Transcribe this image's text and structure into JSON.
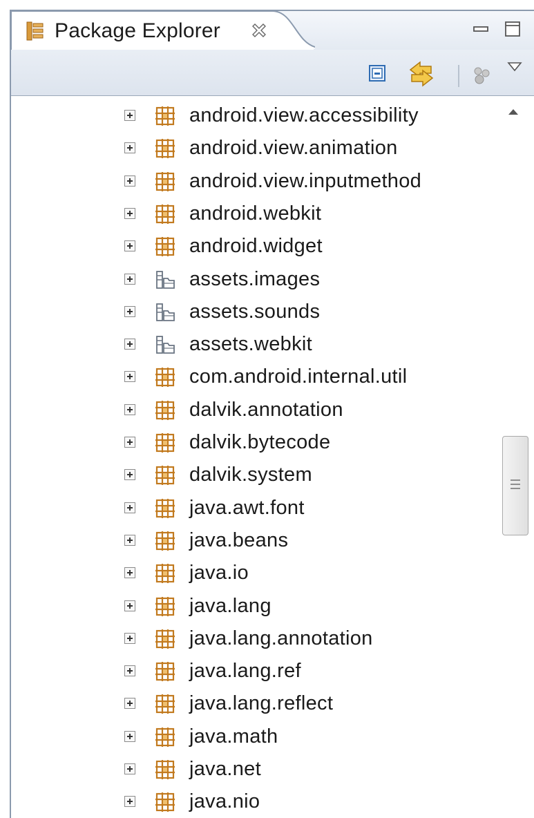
{
  "view": {
    "title": "Package Explorer",
    "icons": {
      "view": "package-explorer-icon",
      "close": "close-icon",
      "minimize": "minimize-icon",
      "maximize": "maximize-icon"
    }
  },
  "toolbar": {
    "buttons": [
      "collapse-all-icon",
      "link-with-editor-icon",
      "focus-on-active-task-icon",
      "view-menu-icon"
    ]
  },
  "tree": {
    "items": [
      {
        "label": "android.view.accessibility",
        "icon": "package-icon"
      },
      {
        "label": "android.view.animation",
        "icon": "package-icon"
      },
      {
        "label": "android.view.inputmethod",
        "icon": "package-icon"
      },
      {
        "label": "android.webkit",
        "icon": "package-icon"
      },
      {
        "label": "android.widget",
        "icon": "package-icon"
      },
      {
        "label": "assets.images",
        "icon": "folder-icon"
      },
      {
        "label": "assets.sounds",
        "icon": "folder-icon"
      },
      {
        "label": "assets.webkit",
        "icon": "folder-icon"
      },
      {
        "label": "com.android.internal.util",
        "icon": "package-icon"
      },
      {
        "label": "dalvik.annotation",
        "icon": "package-icon"
      },
      {
        "label": "dalvik.bytecode",
        "icon": "package-icon"
      },
      {
        "label": "dalvik.system",
        "icon": "package-icon"
      },
      {
        "label": "java.awt.font",
        "icon": "package-icon"
      },
      {
        "label": "java.beans",
        "icon": "package-icon"
      },
      {
        "label": "java.io",
        "icon": "package-icon"
      },
      {
        "label": "java.lang",
        "icon": "package-icon"
      },
      {
        "label": "java.lang.annotation",
        "icon": "package-icon"
      },
      {
        "label": "java.lang.ref",
        "icon": "package-icon"
      },
      {
        "label": "java.lang.reflect",
        "icon": "package-icon"
      },
      {
        "label": "java.math",
        "icon": "package-icon"
      },
      {
        "label": "java.net",
        "icon": "package-icon"
      },
      {
        "label": "java.nio",
        "icon": "package-icon"
      }
    ]
  },
  "scrollbar": {
    "position": 0.43,
    "visible_fraction": 0.14
  },
  "colors": {
    "border": "#8b9aae",
    "package_icon": "#c27a1f",
    "folder_icon": "#6a7482",
    "tab_gradient_top": "#f4f7fb",
    "tab_gradient_bottom": "#e4eaf2"
  }
}
